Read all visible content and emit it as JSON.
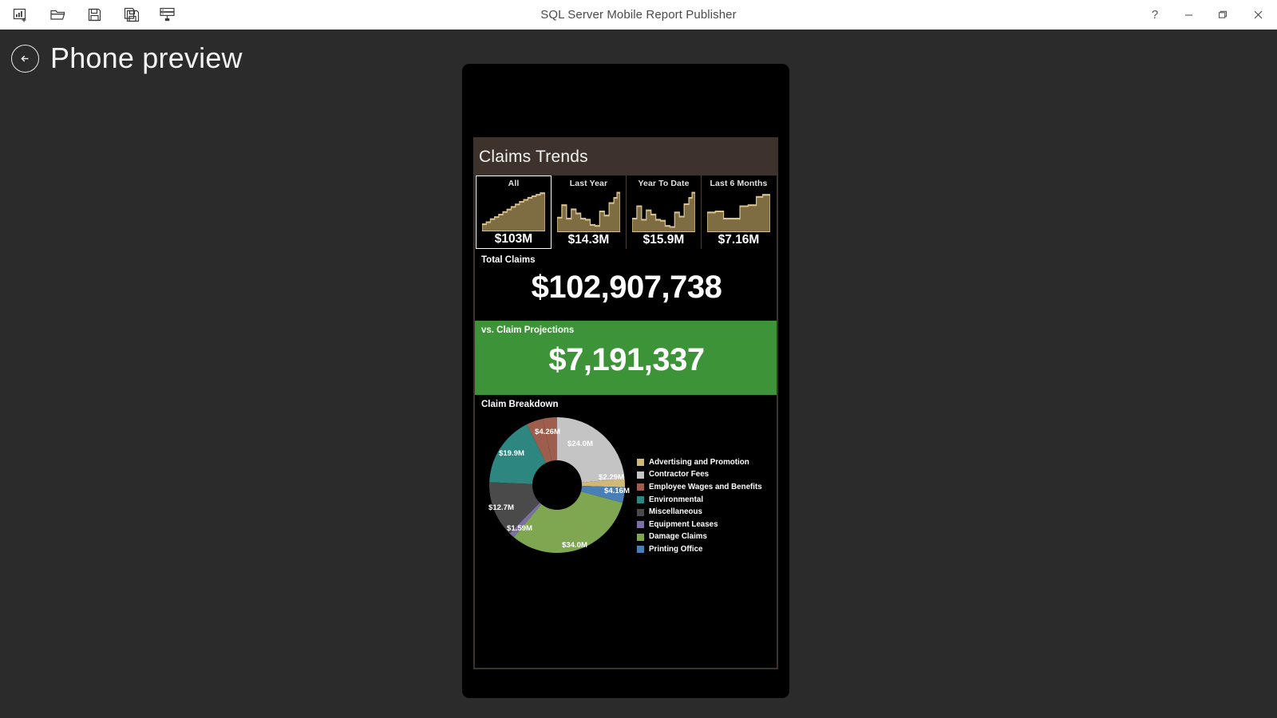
{
  "window": {
    "title": "SQL Server Mobile Report Publisher",
    "toolbar": [
      {
        "name": "new-report-icon",
        "label": "New report"
      },
      {
        "name": "open-folder-icon",
        "label": "Open"
      },
      {
        "name": "save-icon",
        "label": "Save"
      },
      {
        "name": "save-as-icon",
        "label": "Save as"
      },
      {
        "name": "publish-server-icon",
        "label": "Save to server"
      }
    ],
    "controls": {
      "help": "?",
      "minimize": "—",
      "maximize": "❐",
      "close": "✕"
    }
  },
  "page": {
    "back_label": "Back",
    "title": "Phone preview"
  },
  "report": {
    "header_title": "Claims Trends",
    "tiles": [
      {
        "label": "All",
        "value": "$103M",
        "selected": true
      },
      {
        "label": "Last Year",
        "value": "$14.3M",
        "selected": false
      },
      {
        "label": "Year To Date",
        "value": "$15.9M",
        "selected": false
      },
      {
        "label": "Last 6 Months",
        "value": "$7.16M",
        "selected": false
      }
    ],
    "total_claims": {
      "label": "Total Claims",
      "value": "$102,907,738"
    },
    "projections": {
      "label": "vs. Claim Projections",
      "value": "$7,191,337"
    },
    "breakdown": {
      "label": "Claim Breakdown"
    }
  },
  "colors": {
    "chrome_bg": "#2b2b2b",
    "titlebar_bg": "#ffffff",
    "report_frame": "#3d332c",
    "report_bg": "#000000",
    "kpi_green": "#3d9438",
    "spark_fill": "#7e6c42",
    "spark_line": "#d9c18d",
    "tile_selected_border": "#ffffff"
  },
  "chart_data": {
    "type": "pie",
    "title": "Claim Breakdown",
    "legend_position": "right",
    "hole": 0.33,
    "value_unit": "USD millions",
    "categories": [
      "Advertising and Promotion",
      "Contractor Fees",
      "Employee Wages and Benefits",
      "Environmental",
      "Miscellaneous",
      "Equipment Leases",
      "Damage Claims",
      "Printing Office"
    ],
    "colors": [
      "#d2b878",
      "#c4c4c4",
      "#9e5e4e",
      "#2d8680",
      "#4a4a4a",
      "#7c6fa8",
      "#7ba council",
      "#4a7fb5"
    ],
    "slice_colors": [
      "#d2b878",
      "#c4c4c4",
      "#9e5e4e",
      "#2d8680",
      "#4a4a4a",
      "#7c6fa8",
      "#7fa650",
      "#4a7fb5"
    ],
    "values": [
      2.29,
      24.0,
      4.26,
      19.9,
      12.7,
      1.59,
      34.0,
      4.16
    ],
    "labels": [
      "$2.29M",
      "$24.0M",
      "$4.26M",
      "$19.9M",
      "$12.7M",
      "$1.59M",
      "$34.0M",
      "$4.16M"
    ]
  },
  "sparklines": {
    "all": [
      18,
      22,
      26,
      28,
      34,
      40,
      46,
      52,
      58,
      64,
      72,
      80,
      88,
      95,
      100
    ],
    "last_year": [
      32,
      55,
      30,
      48,
      42,
      30,
      28,
      18,
      16,
      40,
      34,
      58,
      70,
      82,
      100
    ],
    "year_to_date": [
      30,
      52,
      28,
      46,
      40,
      28,
      26,
      17,
      15,
      38,
      33,
      56,
      68,
      80,
      100
    ],
    "last_6_months": [
      42,
      44,
      30,
      29,
      29,
      30,
      56,
      58,
      60,
      62,
      82,
      86,
      92,
      96,
      100
    ]
  }
}
